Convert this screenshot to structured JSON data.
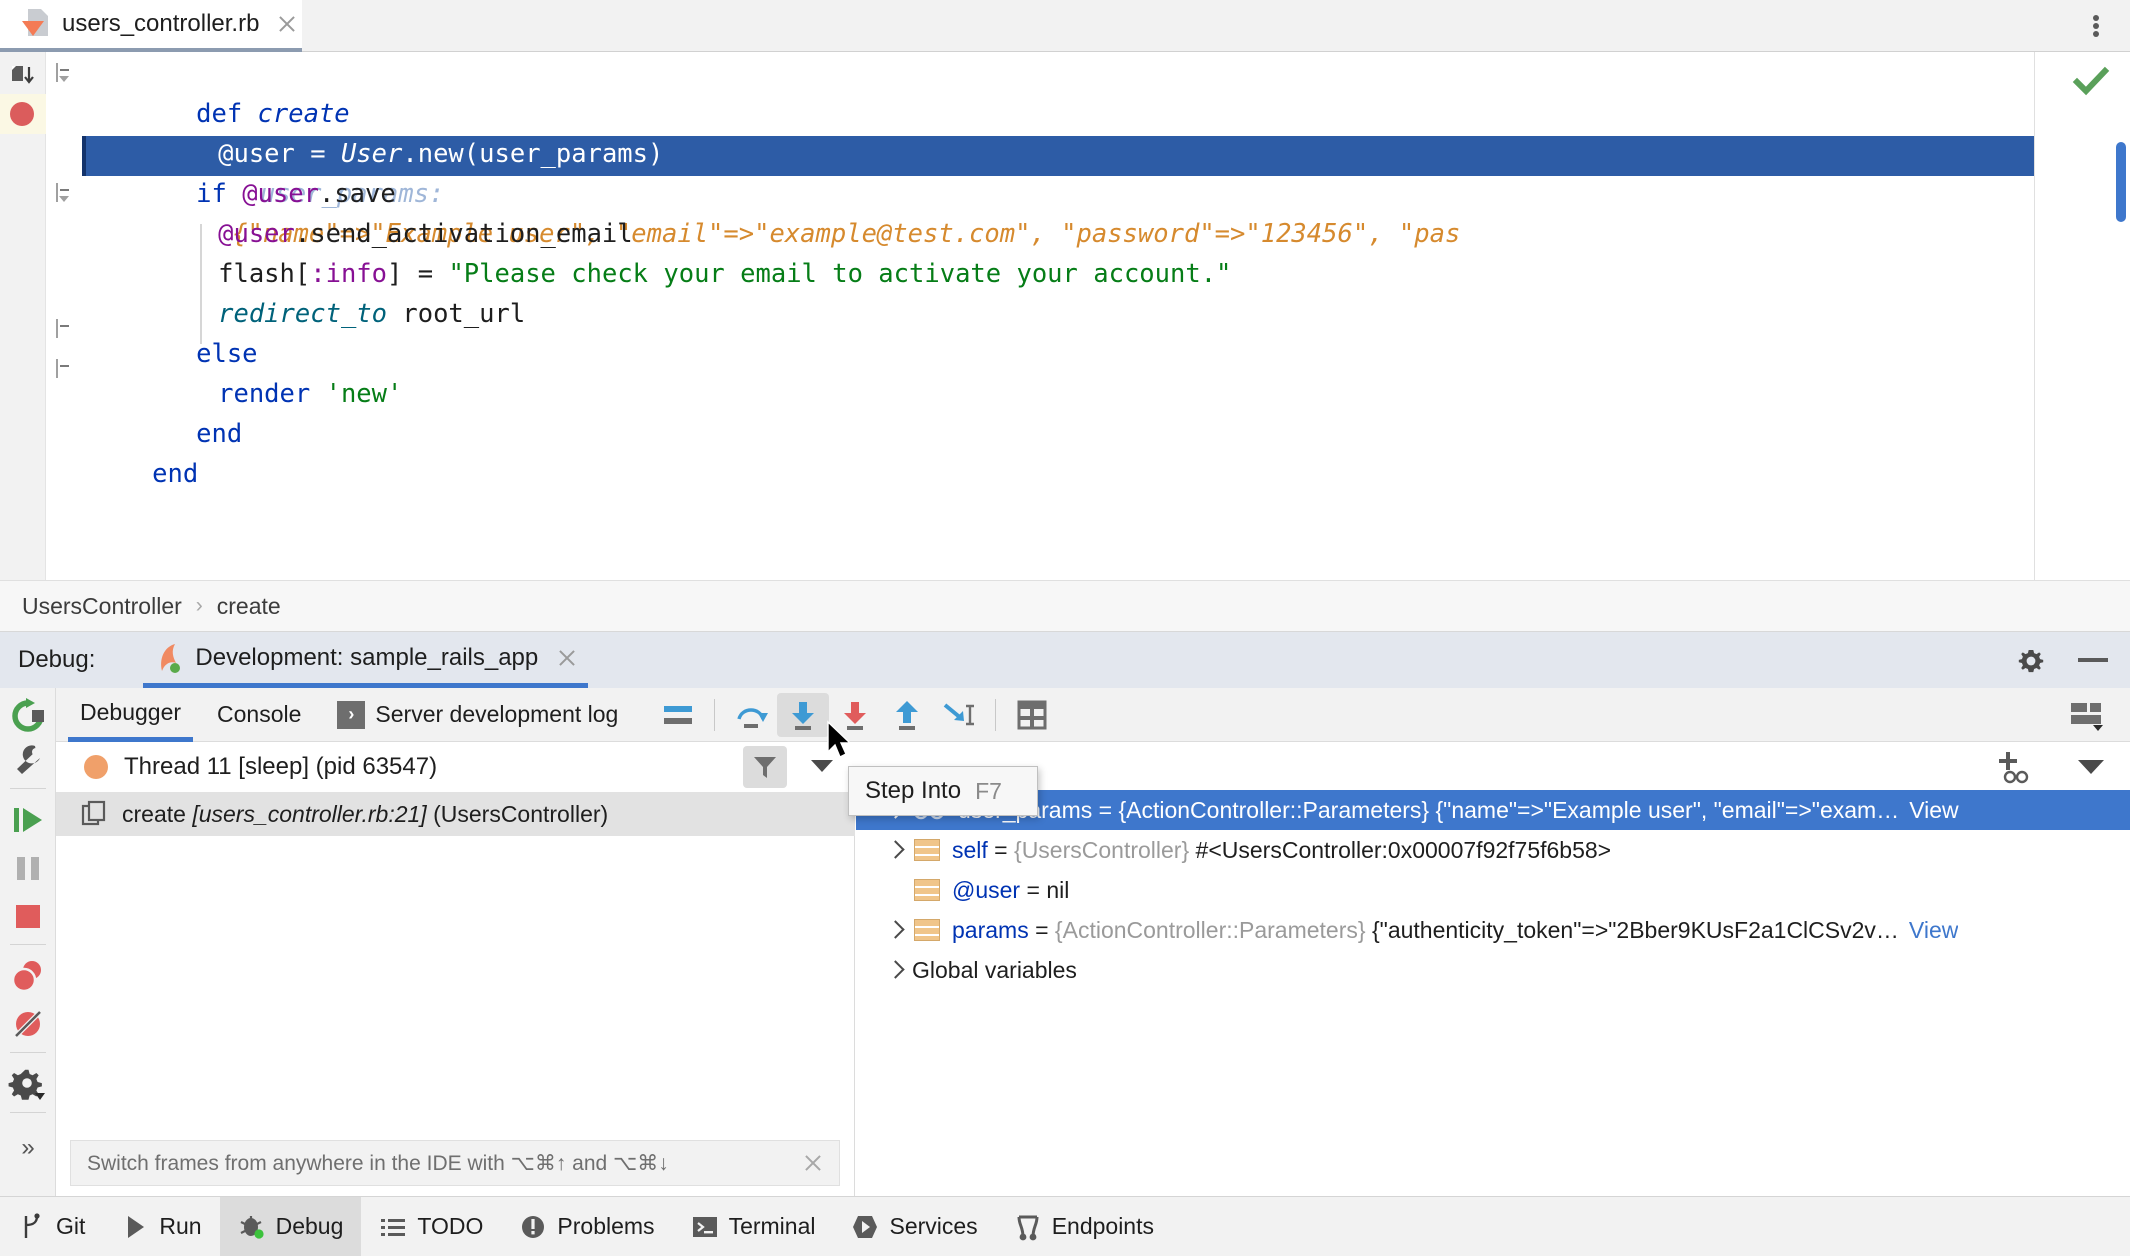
{
  "tabbar": {
    "file_tab": {
      "label": "users_controller.rb",
      "icon": "ruby-file-icon",
      "close": "close-icon"
    },
    "more_icon": "more-options-icon"
  },
  "editor": {
    "lines": [
      {
        "tokens": [
          {
            "t": "def ",
            "c": "kw"
          },
          {
            "t": "create",
            "c": "mdef"
          }
        ]
      },
      {
        "highlighted": true,
        "tokens": [
          {
            "t": "@user ",
            "c": "onwhite-w"
          },
          {
            "t": "= ",
            "c": "onwhite-w"
          },
          {
            "t": "User",
            "c": "onwhite-w"
          },
          {
            "t": ".new(user_params)",
            "c": "onwhite-w"
          }
        ],
        "hint_name": "user_params:",
        "hint_value": "{\"name\"=>\"Example user\", \"email\"=>\"example@test.com\", \"password\"=>\"123456\", \"pas"
      },
      {
        "tokens": [
          {
            "t": "if ",
            "c": "kw"
          },
          {
            "t": "@user",
            "c": "ivar"
          },
          {
            "t": ".save",
            "c": "pln"
          }
        ]
      },
      {
        "tokens": [
          {
            "t": "  @user",
            "c": "ivar"
          },
          {
            "t": ".send_activation_email",
            "c": "pln"
          }
        ]
      },
      {
        "tokens": [
          {
            "t": "  flash[",
            "c": "pln"
          },
          {
            "t": ":info",
            "c": "sym"
          },
          {
            "t": "] = ",
            "c": "pln"
          },
          {
            "t": "\"Please check your email to activate your account.\"",
            "c": "str"
          }
        ]
      },
      {
        "tokens": [
          {
            "t": "  redirect_to",
            "c": "meth"
          },
          {
            "t": " root_url",
            "c": "pln"
          }
        ]
      },
      {
        "tokens": [
          {
            "t": "else",
            "c": "kw"
          }
        ]
      },
      {
        "tokens": [
          {
            "t": "  render ",
            "c": "kw"
          },
          {
            "t": "'new'",
            "c": "str"
          }
        ]
      },
      {
        "tokens": [
          {
            "t": "end",
            "c": "kw"
          }
        ]
      },
      {
        "tokens": [
          {
            "t": "end",
            "c": "kw"
          }
        ]
      }
    ],
    "breakpoint_icon": "breakpoint-icon",
    "bookmark_icon": "bookmark-icon",
    "check_icon": "inspection-ok-icon",
    "hint_color": "#d68a2e",
    "highlight_color": "#2d5ca6"
  },
  "breadcrumb": {
    "items": [
      "UsersController",
      "create"
    ],
    "separator": "›"
  },
  "debug_header": {
    "label": "Debug:",
    "run_config": "Development: sample_rails_app",
    "run_icon": "rails-run-icon",
    "close_icon": "close-icon",
    "gear_icon": "gear-icon",
    "minimize_icon": "minimize-icon",
    "accent": "#3e77cc"
  },
  "left_rail": {
    "buttons": [
      {
        "name": "rerun-button",
        "icon": "rerun-icon"
      },
      {
        "name": "edit-configuration-button",
        "icon": "wrench-icon"
      },
      {
        "name": "resume-program-button",
        "icon": "resume-icon"
      },
      {
        "name": "pause-program-button",
        "icon": "pause-icon"
      },
      {
        "name": "stop-button",
        "icon": "stop-icon"
      },
      {
        "name": "view-breakpoints-button",
        "icon": "breakpoints-icon"
      },
      {
        "name": "mute-breakpoints-button",
        "icon": "mute-breakpoints-icon"
      },
      {
        "name": "settings-button",
        "icon": "gear-dropdown-icon"
      }
    ],
    "expand_icon": "expand-icon",
    "expand_label": "»"
  },
  "panel_tabs": {
    "tabs": [
      {
        "label": "Debugger",
        "active": true,
        "icon": null
      },
      {
        "label": "Console",
        "active": false,
        "icon": null
      },
      {
        "label": "Server development log",
        "active": false,
        "icon": "console-icon",
        "icon_glyph": "›"
      }
    ],
    "toolbar": [
      {
        "name": "show-execution-point-button",
        "icon": "execution-point-icon"
      },
      {
        "name": "step-over-button",
        "icon": "step-over-icon"
      },
      {
        "name": "step-into-button",
        "icon": "step-into-icon",
        "hovered": true
      },
      {
        "name": "force-step-into-button",
        "icon": "force-step-into-icon"
      },
      {
        "name": "step-out-button",
        "icon": "step-out-icon"
      },
      {
        "name": "run-to-cursor-button",
        "icon": "run-to-cursor-icon"
      },
      {
        "name": "evaluate-expression-button",
        "icon": "evaluate-icon"
      }
    ],
    "layout_icon": "layout-settings-icon"
  },
  "tooltip": {
    "label": "Step Into",
    "shortcut": "F7"
  },
  "frames": {
    "thread": {
      "label": "Thread 11 [sleep] (pid 63547)",
      "dot_color": "#f0a06a"
    },
    "filter_icon": "filter-icon",
    "dropdown_icon": "chevron-down-icon",
    "frame": {
      "method": "create",
      "location": "[users_controller.rb:21]",
      "class": "(UsersController)",
      "icon": "frame-icon"
    },
    "hint": {
      "text": "Switch frames from anywhere in the IDE with ⌥⌘↑ and ⌥⌘↓",
      "close": "close-icon"
    }
  },
  "variables": {
    "add_icon": "add-watch-icon",
    "dropdown_icon": "chevron-down-icon",
    "rows": [
      {
        "selected": true,
        "expandable": true,
        "icon": "glasses-icon",
        "name": "user_params",
        "eq": " = ",
        "type": "{ActionController::Parameters}",
        "value": " {\"name\"=>\"Example user\", \"email\"=>\"exam…",
        "link": "View"
      },
      {
        "selected": false,
        "expandable": true,
        "icon": "object-icon",
        "name": "self",
        "eq": " = ",
        "type": "{UsersController}",
        "value": " #<UsersController:0x00007f92f75f6b58>",
        "link": null
      },
      {
        "selected": false,
        "expandable": false,
        "icon": "object-icon",
        "name": "@user",
        "eq": " = ",
        "type": "",
        "value": "nil",
        "link": null
      },
      {
        "selected": false,
        "expandable": true,
        "icon": "object-icon",
        "name": "params",
        "eq": " = ",
        "type": "{ActionController::Parameters}",
        "value": " {\"authenticity_token\"=>\"2Bber9KUsF2a1ClCSv2v…",
        "link": "View"
      },
      {
        "selected": false,
        "expandable": true,
        "icon": null,
        "plain": "Global variables"
      }
    ]
  },
  "statusbar": {
    "items": [
      {
        "label": "Git",
        "icon": "git-icon",
        "active": false
      },
      {
        "label": "Run",
        "icon": "run-icon",
        "active": false
      },
      {
        "label": "Debug",
        "icon": "debug-bug-icon",
        "active": true
      },
      {
        "label": "TODO",
        "icon": "todo-icon",
        "active": false
      },
      {
        "label": "Problems",
        "icon": "problems-icon",
        "active": false
      },
      {
        "label": "Terminal",
        "icon": "terminal-icon",
        "active": false
      },
      {
        "label": "Services",
        "icon": "services-icon",
        "active": false
      },
      {
        "label": "Endpoints",
        "icon": "endpoints-icon",
        "active": false
      }
    ]
  }
}
